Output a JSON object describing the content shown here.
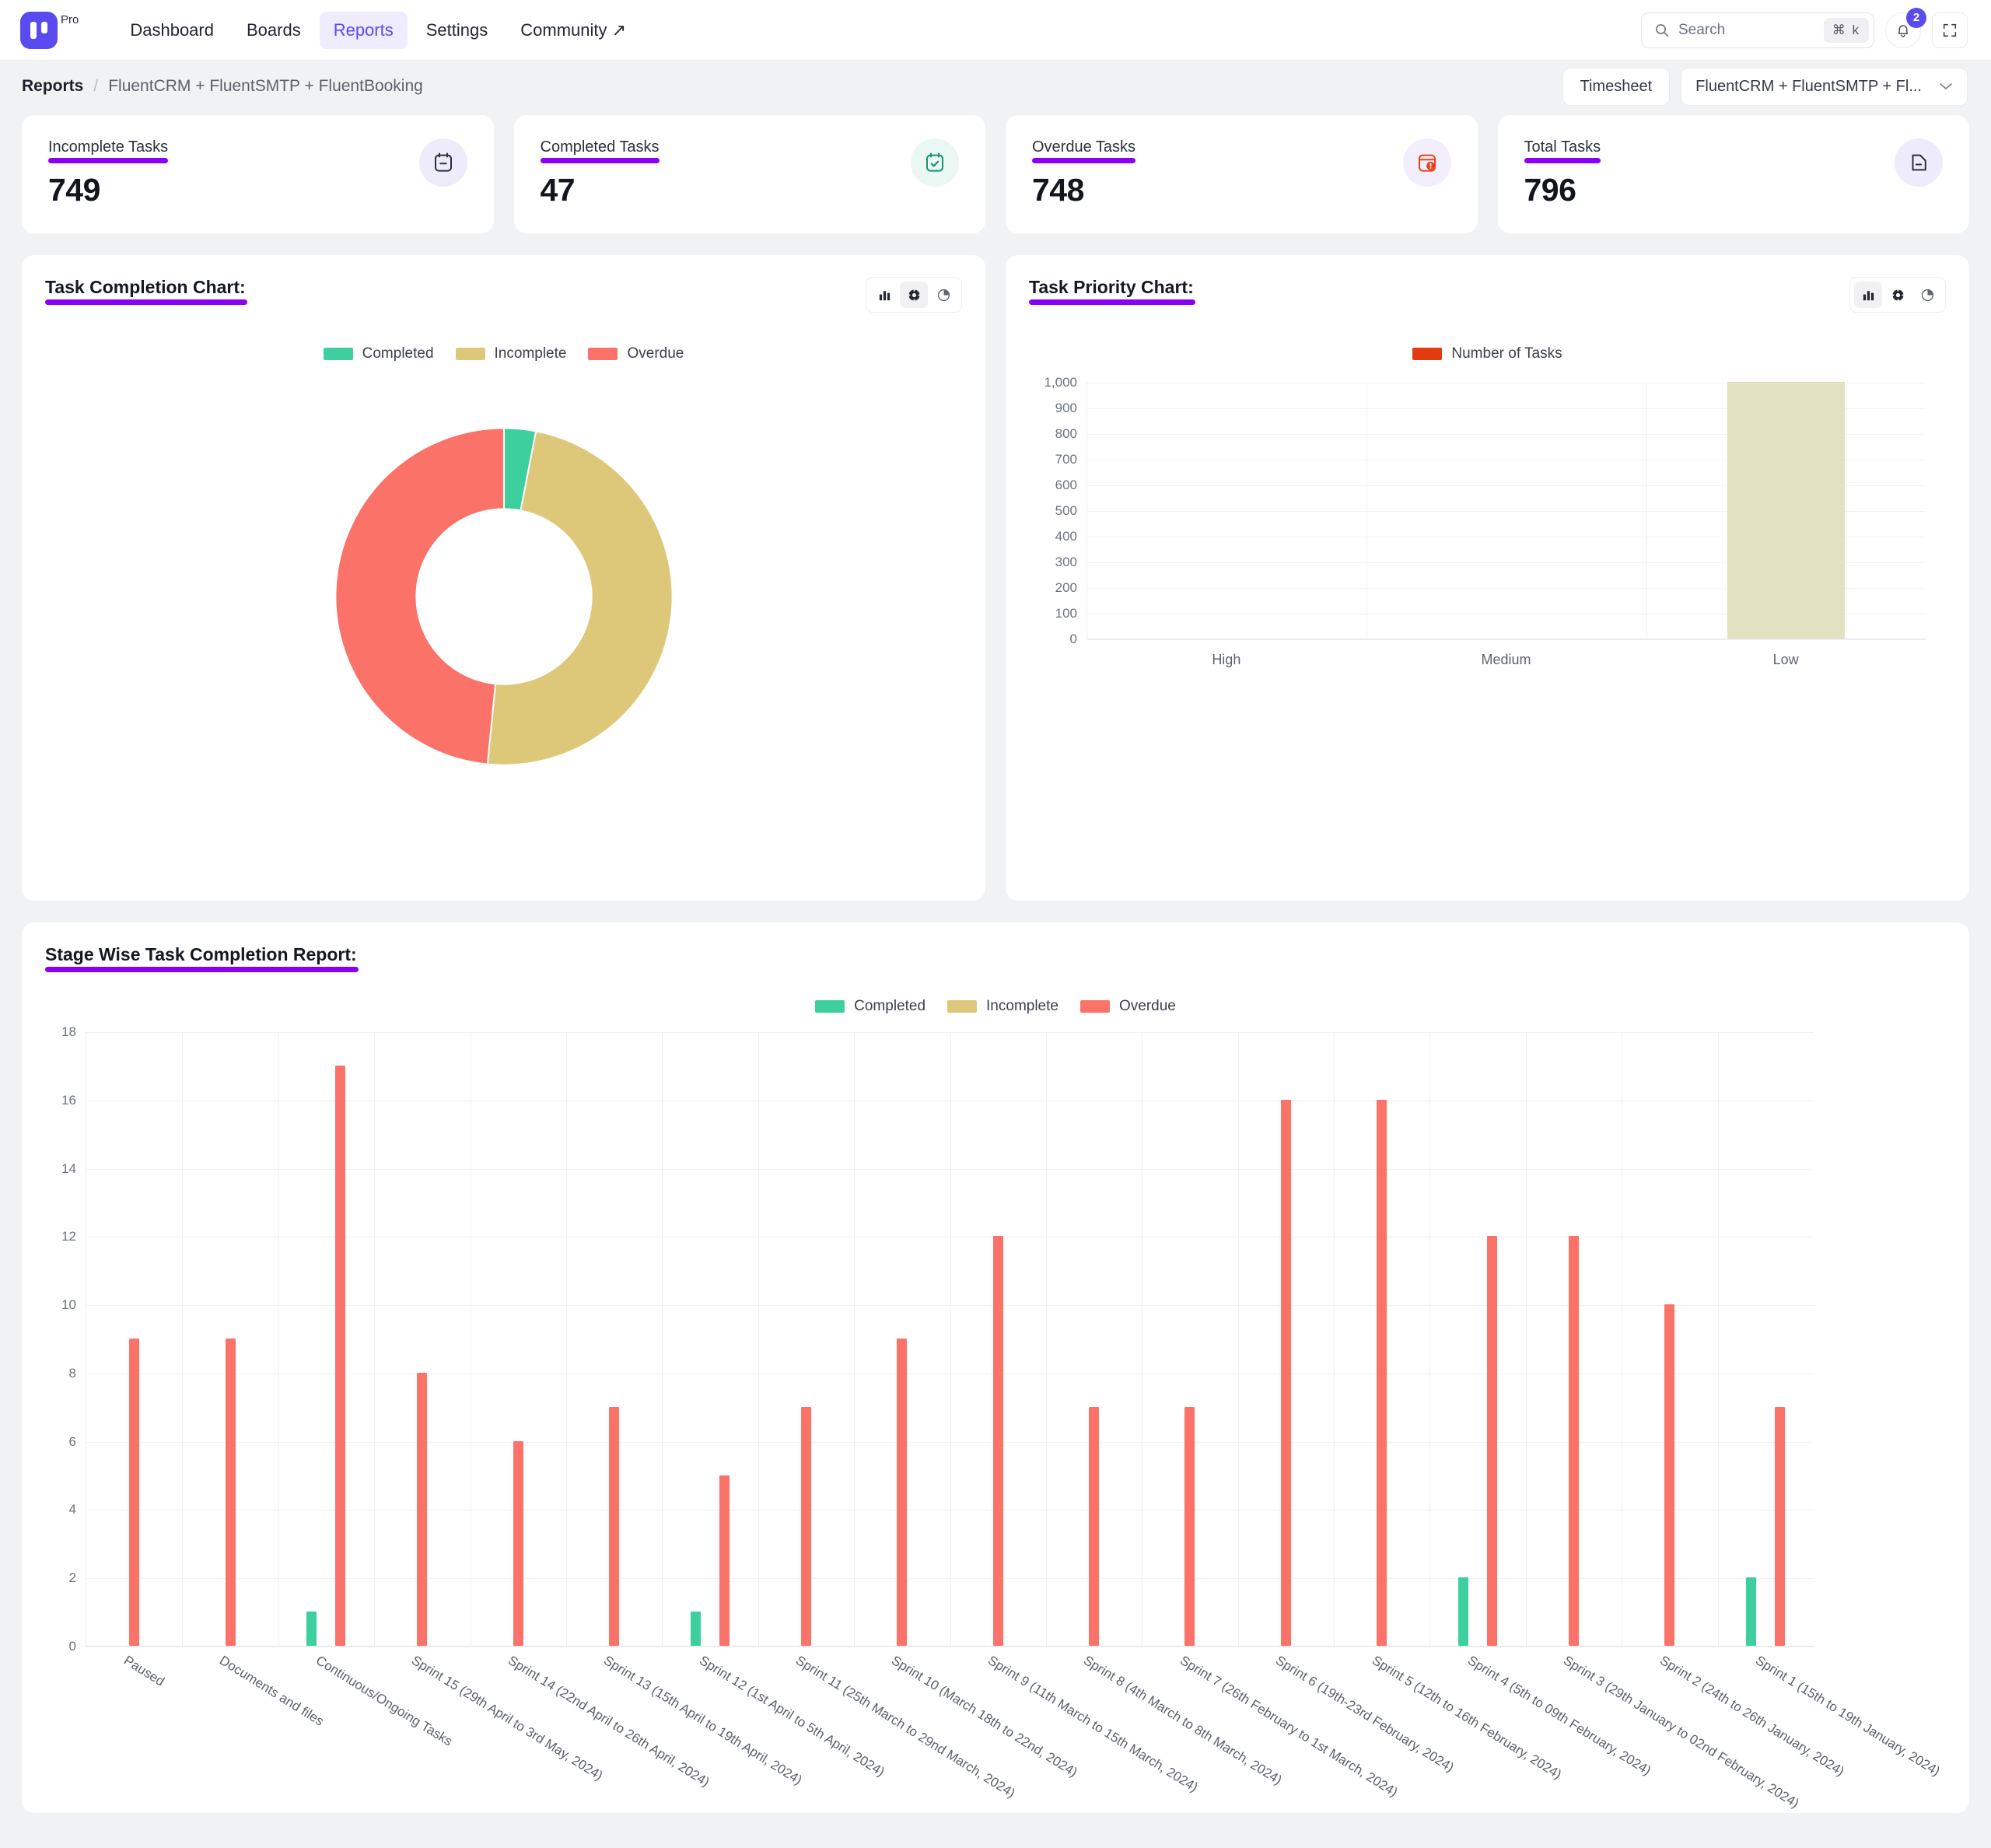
{
  "nav": {
    "brand_pro": "Pro",
    "links": [
      {
        "label": "Dashboard",
        "active": false
      },
      {
        "label": "Boards",
        "active": false
      },
      {
        "label": "Reports",
        "active": true
      },
      {
        "label": "Settings",
        "active": false
      },
      {
        "label": "Community ↗",
        "active": false
      }
    ],
    "search_placeholder": "Search",
    "search_shortcut": "⌘ k",
    "notification_count": "2"
  },
  "breadcrumb": {
    "root": "Reports",
    "separator": "/",
    "current": "FluentCRM + FluentSMTP + FluentBooking",
    "timesheet_label": "Timesheet",
    "project_select_value": "FluentCRM + FluentSMTP + Fl...",
    "chevron": "⌄"
  },
  "stats": [
    {
      "label": "Incomplete Tasks",
      "value": "749",
      "icon": "calendar-minus-icon",
      "tone": "violet"
    },
    {
      "label": "Completed Tasks",
      "value": "47",
      "icon": "calendar-check-icon",
      "tone": "green"
    },
    {
      "label": "Overdue Tasks",
      "value": "748",
      "icon": "calendar-alert-icon",
      "tone": "red"
    },
    {
      "label": "Total Tasks",
      "value": "796",
      "icon": "document-icon",
      "tone": "violet"
    }
  ],
  "colors": {
    "completed": "#3ECF9E",
    "incomplete": "#DDC87A",
    "overdue": "#FA7268",
    "priority_bar": "#E3E2C0",
    "priority_legend": "#E03C10",
    "accent": "#8a00f5",
    "brand": "#5a4bf0"
  },
  "task_completion_panel": {
    "title": "Task Completion Chart:",
    "view_buttons": [
      {
        "name": "bar-view",
        "active": false
      },
      {
        "name": "donut-view",
        "active": true
      },
      {
        "name": "pie-view",
        "active": false
      }
    ]
  },
  "task_priority_panel": {
    "title": "Task Priority Chart:",
    "view_buttons": [
      {
        "name": "bar-view",
        "active": true
      },
      {
        "name": "donut-view",
        "active": false
      },
      {
        "name": "pie-view",
        "active": false
      }
    ]
  },
  "stage_panel": {
    "title": "Stage Wise Task Completion Report:"
  },
  "chart_data": [
    {
      "type": "pie",
      "id": "task-completion-donut",
      "title": "Task Completion Chart:",
      "legend_position": "top",
      "labels": [
        "Completed",
        "Incomplete",
        "Overdue"
      ],
      "values": [
        47,
        749,
        748
      ],
      "colors": [
        "#3ECF9E",
        "#DDC87A",
        "#FA7268"
      ],
      "donut": true,
      "inner_radius_ratio": 0.52
    },
    {
      "type": "bar",
      "id": "task-priority-bar",
      "title": "Task Priority Chart:",
      "legend": [
        "Number of Tasks"
      ],
      "legend_position": "top",
      "categories": [
        "High",
        "Medium",
        "Low"
      ],
      "values": [
        0,
        0,
        1000
      ],
      "ylim": [
        0,
        1000
      ],
      "yticks": [
        "0",
        "100",
        "200",
        "300",
        "400",
        "500",
        "600",
        "700",
        "800",
        "900",
        "1,000"
      ],
      "xlabel": "",
      "ylabel": "",
      "grid": true,
      "bar_color": "#E3E2C0"
    },
    {
      "type": "bar",
      "id": "stage-wise-report",
      "title": "Stage Wise Task Completion Report:",
      "legend": [
        "Completed",
        "Incomplete",
        "Overdue"
      ],
      "legend_position": "top",
      "ylim": [
        0,
        18
      ],
      "yticks": [
        "0",
        "2",
        "4",
        "6",
        "8",
        "10",
        "12",
        "14",
        "16",
        "18"
      ],
      "grid": true,
      "categories": [
        "Paused",
        "Documents and files",
        "Continuous/Ongoing Tasks",
        "Sprint 15 (29th April to 3rd May, 2024)",
        "Sprint 14 (22nd April to 26th April, 2024)",
        "Sprint 13 (15th April to 19th April, 2024)",
        "Sprint 12 (1st April to 5th April, 2024)",
        "Sprint 11 (25th March to 29nd March, 2024)",
        "Sprint 10 (March 18th to 22nd, 2024)",
        "Sprint 9 (11th March to 15th March, 2024)",
        "Sprint 8 (4th March to 8th March, 2024)",
        "Sprint 7 (26th February to 1st March, 2024)",
        "Sprint 6 (19th-23rd February, 2024)",
        "Sprint 5 (12th to 16th February, 2024)",
        "Sprint 4 (5th to 09th February, 2024)",
        "Sprint 3 (29th January to 02nd February, 2024)",
        "Sprint 2 (24th to 26th January, 2024)",
        "Sprint 1 (15th to 19th January, 2024)"
      ],
      "series": [
        {
          "name": "Completed",
          "color": "#3ECF9E",
          "values": [
            0,
            0,
            1,
            0,
            0,
            0,
            1,
            0,
            0,
            0,
            0,
            0,
            0,
            0,
            2,
            0,
            0,
            2
          ]
        },
        {
          "name": "Incomplete",
          "color": "#DDC87A",
          "values": [
            0,
            0,
            0,
            0,
            0,
            0,
            0,
            0,
            0,
            0,
            0,
            0,
            0,
            0,
            0,
            0,
            0,
            0
          ]
        },
        {
          "name": "Overdue",
          "color": "#FA7268",
          "values": [
            9,
            9,
            17,
            8,
            6,
            7,
            5,
            7,
            9,
            12,
            7,
            7,
            16,
            16,
            12,
            12,
            10,
            7
          ]
        }
      ]
    }
  ]
}
